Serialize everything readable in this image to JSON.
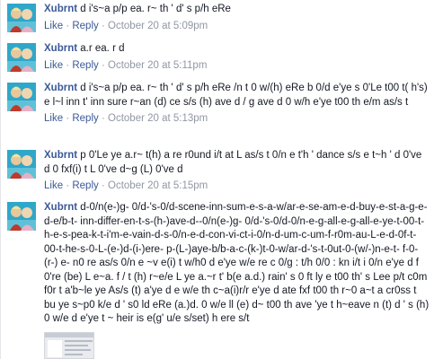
{
  "comments": [
    {
      "author": "Xubrnt",
      "text": "d i's~a p/p ea. r~ th ' d' s p/h eRe",
      "like": "Like",
      "reply": "Reply",
      "sep": "·",
      "timestamp": "October 20 at 5:09pm"
    },
    {
      "author": "Xubrnt",
      "text": "a.r ea. r d",
      "like": "Like",
      "reply": "Reply",
      "sep": "·",
      "timestamp": "October 20 at 5:11pm"
    },
    {
      "author": "Xubrnt",
      "text": "d i's~a p/p ea. r~ th ' d' s p/h eRe /n t 0 w/(h) eRe b 0/d e'ye s 0'Le t00 t( h's) e l~l inn t' inn sure r~an (d) ce s/s (h) ave d / g ave d 0 w/h e'ye t00 th e/m as/s t",
      "like": "Like",
      "reply": "Reply",
      "sep": "·",
      "timestamp": "October 20 at 5:13pm"
    },
    {
      "author": "Xubrnt",
      "text": "p 0'Le ye a.r~ t(h) a re r0und i/t at L as/s t 0/n e t'h ' dance s/s e t~h ' d 0've d 0 fxf(i) t L 0've d~g (L) 0've d",
      "like": "Like",
      "reply": "Reply",
      "sep": "·",
      "timestamp": "October 20 at 5:15pm"
    },
    {
      "author": "Xubrnt",
      "text": "d-0/n(e-)g- 0/d-'s-0/d-scene-inn-sum-e-s-a-w/ar-e-se-am-e-d-buy-e-st-a-g-e-d-e/b-t- inn-differ-en-t-s-(h-)ave-d--0/n(e-)g- 0/d-'s-0/d-0/n-e-g-all-e-g-all-e-ye-t-00-t-h-e-s-pea-k-t-i'm-e-vain-d-s-0/n-e-d-con-vi-ct-i-0/n-d-um-c-um-f-r0m-au-L-e-d-0f-t-00-t-he-s-0-L-(e-)d-(i-)ere- p-(L-)aye-b/b-a-c-(k-)t-0-w/ar-d-'s-t-0ut-0-(w/-)n-e-t- f-0-(r-) e- n0 re as/s 0/n e ~v e(i) t w/h0 d e'ye w/e re c 0/g : t/h 0/0 : kn i/t i 0/n e'ye d f 0're (be) L e~a. f / t (h) r~e/e L ye a.~r t' b(e a.d.) rain' s 0 ft ly e t00 th' s Lee p/t c0m f0r t a'b~le ye As/s (t) a'ye d e w/e th c~a(i)r/r e'ye d ate fxf t00 th r~0 a~t a cr0ss t bu ye s~p0 k/e d ' s0 ld eRe (a.)d. 0 w/e ll (e) d~ t00 th ave 'ye t h~eave n (t) d ' s (h) 0 w/e d e'ye t ~ heir is e(g' u/e s/set) h ere s/t"
    }
  ],
  "colors": {
    "link": "#3b5998",
    "meta": "#9197a3",
    "text": "#141823"
  },
  "icons": {
    "avatar": "profile-photo",
    "attachment": "image-thumbnail"
  }
}
